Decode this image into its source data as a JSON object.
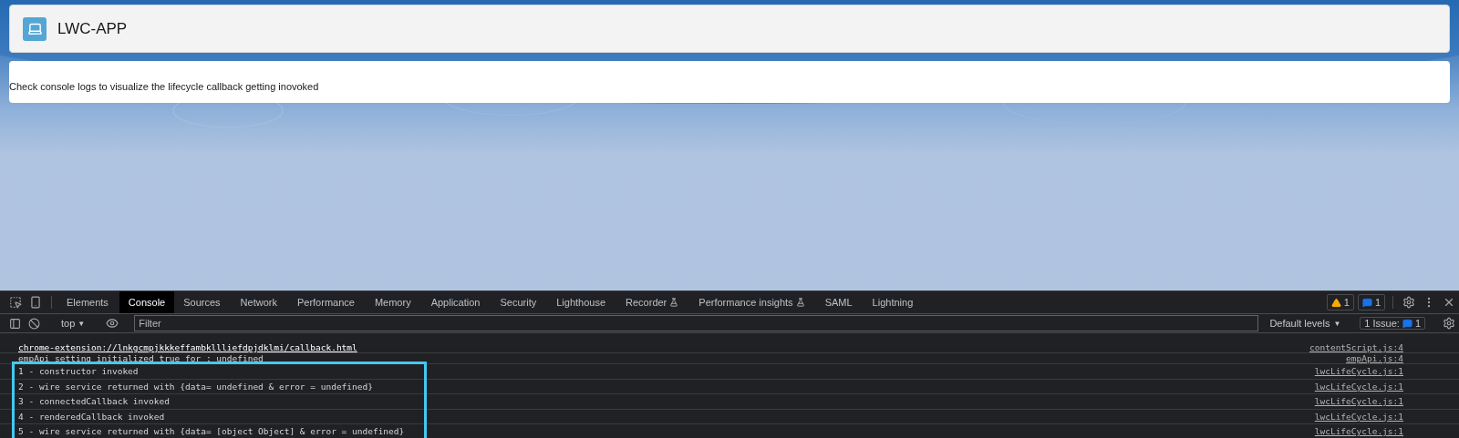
{
  "app": {
    "title": "LWC-APP"
  },
  "card": {
    "message": "Check console logs to visualize the lifecycle callback getting inovoked"
  },
  "devtools": {
    "tabs": [
      {
        "label": "Elements",
        "selected": false,
        "experimental": false
      },
      {
        "label": "Console",
        "selected": true,
        "experimental": false
      },
      {
        "label": "Sources",
        "selected": false,
        "experimental": false
      },
      {
        "label": "Network",
        "selected": false,
        "experimental": false
      },
      {
        "label": "Performance",
        "selected": false,
        "experimental": false
      },
      {
        "label": "Memory",
        "selected": false,
        "experimental": false
      },
      {
        "label": "Application",
        "selected": false,
        "experimental": false
      },
      {
        "label": "Security",
        "selected": false,
        "experimental": false
      },
      {
        "label": "Lighthouse",
        "selected": false,
        "experimental": false
      },
      {
        "label": "Recorder",
        "selected": false,
        "experimental": true
      },
      {
        "label": "Performance insights",
        "selected": false,
        "experimental": true
      },
      {
        "label": "SAML",
        "selected": false,
        "experimental": false
      },
      {
        "label": "Lightning",
        "selected": false,
        "experimental": false
      }
    ],
    "warnings": "1",
    "messages": "1",
    "context": "top",
    "dropdown_caret": "▼",
    "filter": {
      "placeholder": "Filter"
    },
    "levels": "Default levels",
    "issues": {
      "label": "1 Issue:",
      "count": "1"
    },
    "logs": [
      {
        "text": "chrome-extension://lnkgcmpjkkkeffambkllliefdpjdklmi/callback.html",
        "source": "contentScript.js:4",
        "kind": "link",
        "highlighted": false
      },
      {
        "text": "empApi setting initialized true for : undefined",
        "source": "empApi.js:4",
        "kind": "plain",
        "highlighted": false
      },
      {
        "text": "1 - constructor invoked",
        "source": "lwcLifeCycle.js:1",
        "kind": "plain",
        "highlighted": true
      },
      {
        "text": "2 - wire service returned with {data= undefined & error = undefined}",
        "source": "lwcLifeCycle.js:1",
        "kind": "plain",
        "highlighted": true
      },
      {
        "text": "3 - connectedCallback invoked",
        "source": "lwcLifeCycle.js:1",
        "kind": "plain",
        "highlighted": true
      },
      {
        "text": "4 - renderedCallback invoked",
        "source": "lwcLifeCycle.js:1",
        "kind": "plain",
        "highlighted": true
      },
      {
        "text": "5 - wire service returned with {data= [object Object] & error = undefined}",
        "source": "lwcLifeCycle.js:1",
        "kind": "plain",
        "highlighted": true
      }
    ]
  }
}
